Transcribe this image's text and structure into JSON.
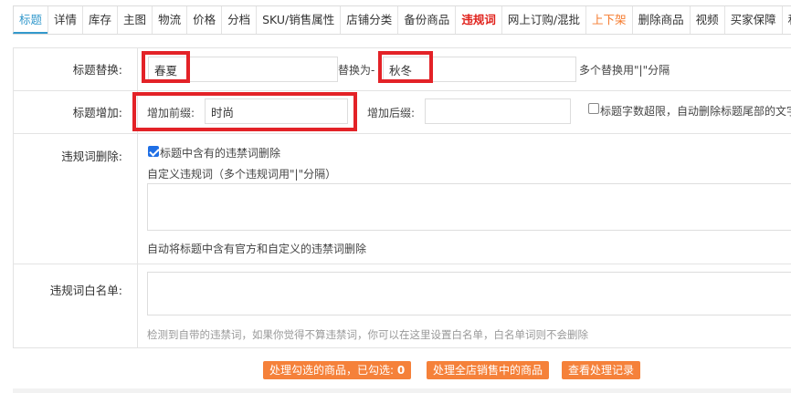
{
  "tabs": [
    {
      "label": "标题",
      "style": "active"
    },
    {
      "label": "详情",
      "style": ""
    },
    {
      "label": "库存",
      "style": ""
    },
    {
      "label": "主图",
      "style": ""
    },
    {
      "label": "物流",
      "style": ""
    },
    {
      "label": "价格",
      "style": ""
    },
    {
      "label": "分档",
      "style": ""
    },
    {
      "label": "SKU/销售属性",
      "style": ""
    },
    {
      "label": "店铺分类",
      "style": ""
    },
    {
      "label": "备份商品",
      "style": ""
    },
    {
      "label": "违规词",
      "style": "red"
    },
    {
      "label": "网上订购/混批",
      "style": ""
    },
    {
      "label": "上下架",
      "style": "orange"
    },
    {
      "label": "删除商品",
      "style": ""
    },
    {
      "label": "视频",
      "style": ""
    },
    {
      "label": "买家保障",
      "style": ""
    },
    {
      "label": "私",
      "style": ""
    }
  ],
  "title_replace": {
    "label": "标题替换:",
    "from_value": "春夏",
    "to_label": "替换为-",
    "to_value": "秋冬",
    "hint": "多个替换用\"|\"分隔"
  },
  "title_add": {
    "label": "标题增加:",
    "prefix_label": "增加前缀:",
    "prefix_value": "时尚",
    "suffix_label": "增加后缀:",
    "suffix_value": "",
    "overflow_label": "标题字数超限，自动删除标题尾部的文字",
    "overflow_checked": false
  },
  "violation_delete": {
    "label": "违规词删除:",
    "checkbox_label": "标题中含有的违禁词删除",
    "checked": true,
    "custom_label": "自定义违规词（多个违规词用\"|\"分隔）",
    "custom_value": "",
    "note": "自动将标题中含有官方和自定义的违禁词删除"
  },
  "whitelist": {
    "label": "违规词白名单:",
    "value": "",
    "note": "检测到自带的违禁词，如果你觉得不算违禁词，你可以在这里设置白名单，白名单词则不会删除"
  },
  "buttons": {
    "process_selected": "处理勾选的商品，已勾选:",
    "selected_count": "0",
    "process_all": "处理全店销售中的商品",
    "view_records": "查看处理记录"
  },
  "colors": {
    "accent": "#3399cc",
    "highlight_box": "#e32227",
    "button": "#f5813a",
    "violation_tab": "#e0201a",
    "shelf_tab": "#f57a2c"
  }
}
